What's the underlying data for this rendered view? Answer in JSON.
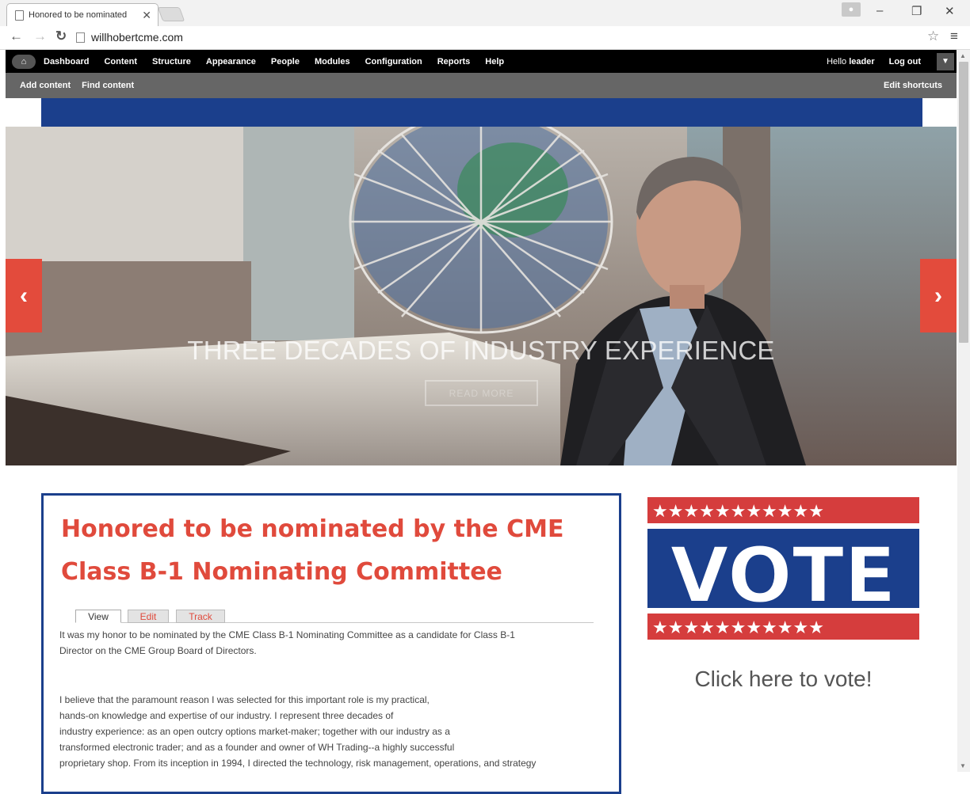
{
  "browser": {
    "tab_title": "Honored to be nominated",
    "url": "willhobertcme.com"
  },
  "admin_menu": {
    "items": [
      "Dashboard",
      "Content",
      "Structure",
      "Appearance",
      "People",
      "Modules",
      "Configuration",
      "Reports",
      "Help"
    ],
    "hello": "Hello",
    "username": "leader",
    "logout": "Log out"
  },
  "shortcuts": {
    "items": [
      "Add content",
      "Find content"
    ],
    "edit": "Edit shortcuts"
  },
  "hero": {
    "caption": "THREE DECADES OF INDUSTRY EXPERIENCE",
    "button": "READ MORE",
    "prev": "‹",
    "next": "›"
  },
  "node": {
    "title": "Honored to be nominated by the CME Class B-1 Nominating Committee",
    "tabs": [
      "View",
      "Edit",
      "Track"
    ],
    "paragraph1": [
      "It was my honor to be nominated by the CME Class B-1 Nominating Committee as a candidate for Class B-1",
      "Director on the CME Group Board of Directors."
    ],
    "paragraph2": [
      "I believe that the paramount reason I was selected for this important role is my practical,",
      "hands-on knowledge and expertise of our industry.   I represent three decades of",
      "industry experience:  as an open outcry options market-maker; together with our industry as a",
      "transformed electronic trader; and  as a founder and owner of WH Trading--a highly successful",
      "proprietary shop. From its inception in 1994, I directed the technology, risk management, operations, and strategy"
    ]
  },
  "sidebar": {
    "vote_text": "VOTE",
    "vote_link": "Click here to vote!"
  },
  "colors": {
    "accent_red": "#e04a3c",
    "brand_blue": "#1b3f8c",
    "admin_black": "#000000"
  }
}
